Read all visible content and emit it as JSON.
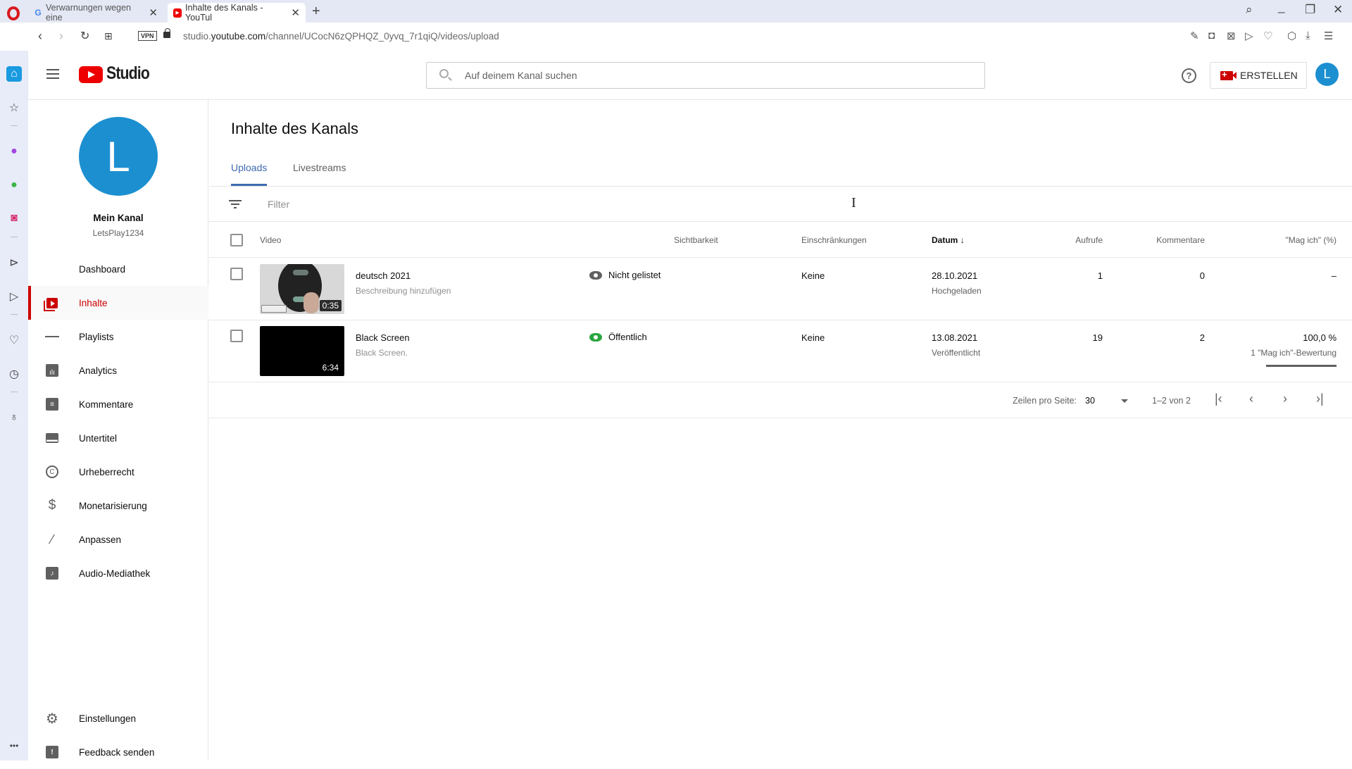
{
  "browser": {
    "tabs": [
      {
        "label": "Verwarnungen wegen eine",
        "favicon": "google-icon"
      },
      {
        "label": "Inhalte des Kanals - YouTul",
        "favicon": "youtube-icon",
        "active": true
      }
    ],
    "new_tab": "+",
    "window_controls": {
      "search": "⌕",
      "minimize": "_",
      "restore": "❐",
      "close": "✕"
    },
    "url_prefix": "studio.",
    "url_domain": "youtube.com",
    "url_path": "/channel/UCocN6zQPHQZ_0yvq_7r1qiQ/videos/upload",
    "vpn": "VPN",
    "nav": {
      "back": "‹",
      "forward": "›",
      "reload": "↻",
      "tabs": "⊞"
    },
    "extensions": [
      "snapshot-edit-icon",
      "camera-icon",
      "shield-icon",
      "send-icon",
      "heart-icon",
      "box-icon",
      "download-icon",
      "menu-icon"
    ]
  },
  "opera_sidebar": {
    "items": [
      "home-icon",
      "star-icon",
      "messenger-icon",
      "whatsapp-icon",
      "instagram-icon",
      "player-icon",
      "send-icon",
      "heart-icon",
      "history-icon",
      "lightbulb-icon"
    ],
    "more": "•••"
  },
  "header": {
    "logo_text": "Studio",
    "search_placeholder": "Auf deinem Kanal suchen",
    "help": "?",
    "create_label": "ERSTELLEN",
    "avatar_letter": "L"
  },
  "channel": {
    "avatar_letter": "L",
    "name": "Mein Kanal",
    "handle": "LetsPlay1234",
    "avatar_color": "#1c8fd1"
  },
  "sidebar": {
    "items": [
      {
        "label": "Dashboard",
        "icon": "dashboard-icon"
      },
      {
        "label": "Inhalte",
        "icon": "content-icon",
        "active": true
      },
      {
        "label": "Playlists",
        "icon": "playlist-icon"
      },
      {
        "label": "Analytics",
        "icon": "analytics-icon"
      },
      {
        "label": "Kommentare",
        "icon": "comments-icon"
      },
      {
        "label": "Untertitel",
        "icon": "subtitles-icon"
      },
      {
        "label": "Urheberrecht",
        "icon": "copyright-icon"
      },
      {
        "label": "Monetarisierung",
        "icon": "dollar-icon"
      },
      {
        "label": "Anpassen",
        "icon": "magic-wand-icon"
      },
      {
        "label": "Audio-Mediathek",
        "icon": "audio-library-icon"
      }
    ],
    "bottom": [
      {
        "label": "Einstellungen",
        "icon": "gear-icon"
      },
      {
        "label": "Feedback senden",
        "icon": "feedback-icon"
      }
    ],
    "accent": "#cc0000"
  },
  "main": {
    "title": "Inhalte des Kanals",
    "tabs": [
      {
        "label": "Uploads",
        "active": true
      },
      {
        "label": "Livestreams"
      }
    ],
    "filter_placeholder": "Filter",
    "columns": {
      "video": "Video",
      "visibility": "Sichtbarkeit",
      "restrictions": "Einschränkungen",
      "date": "Datum",
      "date_sort": "↓",
      "views": "Aufrufe",
      "comments": "Kommentare",
      "likes": "\"Mag ich\" (%)"
    },
    "rows": [
      {
        "title": "deutsch 2021",
        "description": "Beschreibung hinzufügen",
        "duration": "0:35",
        "visibility": "Nicht gelistet",
        "visibility_color": "#606060",
        "restrictions": "Keine",
        "date": "28.10.2021",
        "date_status": "Hochgeladen",
        "views": "1",
        "comments": "0",
        "likes": "–",
        "likes_sub": "",
        "like_ratio": null
      },
      {
        "title": "Black Screen",
        "description": "Black Screen.",
        "duration": "6:34",
        "visibility": "Öffentlich",
        "visibility_color": "#2ba640",
        "restrictions": "Keine",
        "date": "13.08.2021",
        "date_status": "Veröffentlicht",
        "views": "19",
        "comments": "2",
        "likes": "100,0 %",
        "likes_sub": "1 \"Mag ich\"-Bewertung",
        "like_ratio": 1.0
      }
    ],
    "pagination": {
      "rows_label": "Zeilen pro Seite:",
      "rows_value": "30",
      "range": "1–2 von 2",
      "first": "|‹",
      "prev": "‹",
      "next": "›",
      "last": "›|"
    }
  }
}
